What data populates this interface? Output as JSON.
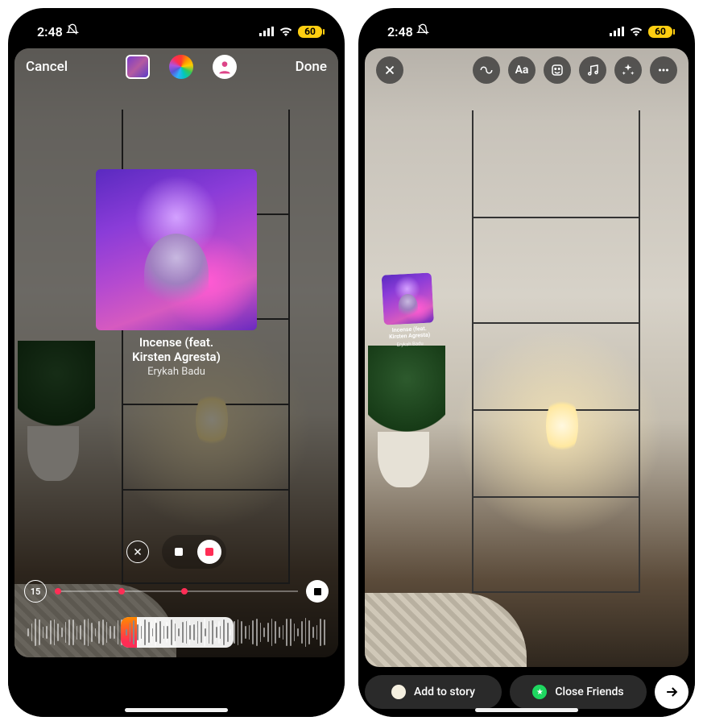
{
  "status": {
    "time": "2:48",
    "battery": "60"
  },
  "left": {
    "cancel": "Cancel",
    "done": "Done",
    "music": {
      "title_line1": "Incense (feat.",
      "title_line2": "Kirsten Agresta)",
      "artist": "Erykah Badu"
    },
    "duration_badge": "15"
  },
  "right": {
    "music": {
      "title_line1": "Incense (feat.",
      "title_line2": "Kirsten Agresta)",
      "artist": "Erykah Badu"
    },
    "add_to_story": "Add to story",
    "close_friends": "Close Friends"
  },
  "icons": {
    "bell_off": "bell-slash",
    "signal": "cellular",
    "wifi": "wifi",
    "close": "xmark",
    "infinity": "infinity",
    "text": "Aa",
    "sticker": "sticker",
    "music": "music-note",
    "sparkle": "sparkle",
    "more": "ellipsis",
    "arrow": "arrow-right",
    "clear": "x-circle"
  }
}
